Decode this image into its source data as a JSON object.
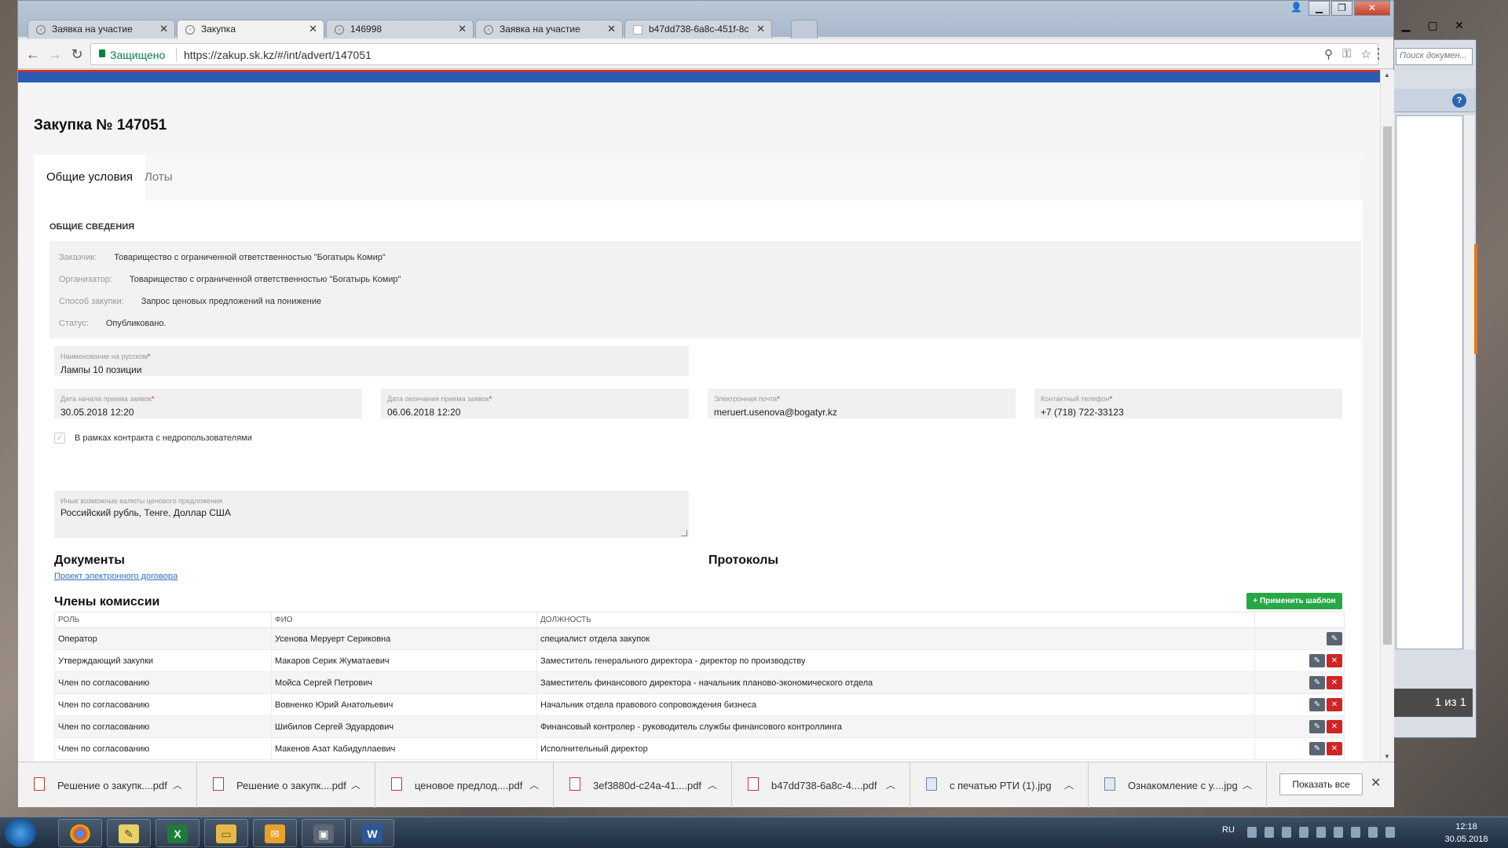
{
  "browser": {
    "tabs": [
      {
        "title": "Заявка на участие",
        "active": false
      },
      {
        "title": "Закупка",
        "active": true
      },
      {
        "title": "146998",
        "active": false
      },
      {
        "title": "Заявка на участие",
        "active": false
      },
      {
        "title": "b47dd738-6a8c-451f-8c",
        "active": false
      }
    ],
    "secure_label": "Защищено",
    "url": "https://zakup.sk.kz/#/int/advert/147051"
  },
  "page": {
    "title": "Закупка № 147051",
    "tabs": [
      "Общие условия",
      "Лоты"
    ],
    "section_title": "ОБЩИЕ СВЕДЕНИЯ",
    "info": [
      {
        "label": "Заказчик:",
        "value": "Товарищество с ограниченной ответственностью \"Богатырь Комир\""
      },
      {
        "label": "Организатор:",
        "value": "Товарищество с ограниченной ответственностью \"Богатырь Комир\""
      },
      {
        "label": "Способ закупки:",
        "value": "Запрос ценовых предложений на понижение"
      },
      {
        "label": "Статус:",
        "value": "Опубликовано."
      }
    ],
    "fields": {
      "name_ru": {
        "label": "Наименование на русском",
        "value": "Лампы 10 позиции"
      },
      "start_date": {
        "label": "Дата начала приема заявок",
        "value": "30.05.2018 12:20"
      },
      "end_date": {
        "label": "Дата окончания приема заявок",
        "value": "06.06.2018 12:20"
      },
      "email": {
        "label": "Электронная почта",
        "value": "meruert.usenova@bogatyr.kz"
      },
      "phone": {
        "label": "Контактный телефон",
        "value": "+7 (718) 722-33123"
      },
      "currencies": {
        "label": "Иные возможные валюты ценового предложения",
        "value": "Российский  рубль, Тенге, Доллар США"
      }
    },
    "required_mark": "*",
    "checkbox_label": "В рамках контракта с недропользователями",
    "documents_heading": "Документы",
    "documents_link": "Проект электронного договора",
    "protocols_heading": "Протоколы",
    "commission_heading": "Члены комиссии",
    "apply_template_label": "+ Применить шаблон",
    "commission_columns": [
      "РОЛЬ",
      "ФИО",
      "ДОЛЖНОСТЬ"
    ],
    "commission_rows": [
      {
        "role": "Оператор",
        "name": "Усенова Меруерт Сериковна",
        "position": "специалист отдела закупок"
      },
      {
        "role": "Утверждающий закупки",
        "name": "Макаров Серик Жуматаевич",
        "position": "Заместитель генерального директора - директор по производству"
      },
      {
        "role": "Член по согласованию",
        "name": "Мойса Сергей Петрович",
        "position": "Заместитель финансового директора - начальник планово-экономического отдела"
      },
      {
        "role": "Член по согласованию",
        "name": "Вовненко Юрий Анатольевич",
        "position": "Начальник отдела правового сопровождения бизнеса"
      },
      {
        "role": "Член по согласованию",
        "name": "Шибилов Сергей Эдуардович",
        "position": "Финансовый контролер - руководитель службы финансового контроллинга"
      },
      {
        "role": "Член по согласованию",
        "name": "Макенов Азат Кабидуллаевич",
        "position": "Исполнительный директор"
      }
    ]
  },
  "downloads": {
    "items": [
      {
        "name": "Решение о закупк....pdf",
        "type": "pdf"
      },
      {
        "name": "Решение о закупк....pdf",
        "type": "pdf"
      },
      {
        "name": "ценовое предлод....pdf",
        "type": "pdf"
      },
      {
        "name": "3ef3880d-c24a-41....pdf",
        "type": "pdf"
      },
      {
        "name": "b47dd738-6a8c-4....pdf",
        "type": "pdf"
      },
      {
        "name": "с печатью РТИ (1).jpg",
        "type": "image"
      },
      {
        "name": "Ознакомление с у....jpg",
        "type": "image"
      }
    ],
    "show_all_label": "Показать все"
  },
  "desktop": {
    "search_placeholder": "Поиск докумен...",
    "page_counter": "1 из 1"
  },
  "taskbar": {
    "language": "RU",
    "time": "12:18",
    "date": "30.05.2018"
  },
  "colors": {
    "accent_green": "#27a846",
    "delete_red": "#d02525",
    "link_blue": "#2a6fc9",
    "header_blue": "#2a5bb5"
  }
}
